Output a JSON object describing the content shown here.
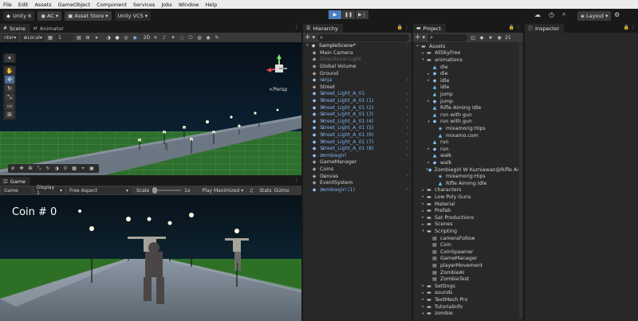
{
  "menu": [
    "File",
    "Edit",
    "Assets",
    "GameObject",
    "Component",
    "Services",
    "Jobs",
    "Window",
    "Help"
  ],
  "toolbar": {
    "unity_version": "Unity 6",
    "account": "AC",
    "asset_store": "Asset Store",
    "vcs": "Unity VCS",
    "layout": "Layout",
    "play_icons": [
      "play-icon",
      "pause-icon",
      "step-icon"
    ]
  },
  "scene_panel": {
    "tabs": [
      "Scene",
      "Animator"
    ],
    "pivot": "nter",
    "space": "Local",
    "grid_value": "1",
    "persp_label": "<Persp"
  },
  "game_panel": {
    "tab": "Game",
    "mode": "Game",
    "display": "Display 1",
    "aspect": "Free Aspect",
    "scale_label": "Scale",
    "scale_value": "1x",
    "play_mode": "Play Maximized",
    "stats": "Stats",
    "gizmos": "Gizmo",
    "hud_coin": "Coin # 0"
  },
  "hierarchy": {
    "tab": "Hierarchy",
    "scene": "SampleScene*",
    "items": [
      {
        "label": "Main Camera",
        "depth": 1,
        "icon": "cube-icon",
        "color": "grey",
        "arrow": ""
      },
      {
        "label": "Directional Light",
        "depth": 1,
        "icon": "cube-icon",
        "color": "dim",
        "arrow": ""
      },
      {
        "label": "Global Volume",
        "depth": 1,
        "icon": "cube-icon",
        "color": "grey",
        "arrow": ""
      },
      {
        "label": "Ground",
        "depth": 1,
        "icon": "cube-icon",
        "color": "grey",
        "arrow": ""
      },
      {
        "label": "ninja",
        "depth": 1,
        "icon": "prefab-icon",
        "color": "blue",
        "arrow": "▸"
      },
      {
        "label": "Street",
        "depth": 1,
        "icon": "cube-icon",
        "color": "grey",
        "arrow": ""
      },
      {
        "label": "Street_Light_A_01",
        "depth": 1,
        "icon": "prefab-icon",
        "color": "blue",
        "arrow": "▸"
      },
      {
        "label": "Street_Light_A_01 (1)",
        "depth": 1,
        "icon": "prefab-icon",
        "color": "blue",
        "arrow": "▸"
      },
      {
        "label": "Street_Light_A_01 (2)",
        "depth": 1,
        "icon": "prefab-icon",
        "color": "blue",
        "arrow": "▸"
      },
      {
        "label": "Street_Light_A_01 (3)",
        "depth": 1,
        "icon": "prefab-icon",
        "color": "blue",
        "arrow": "▸"
      },
      {
        "label": "Street_Light_A_01 (4)",
        "depth": 1,
        "icon": "prefab-icon",
        "color": "blue",
        "arrow": "▸"
      },
      {
        "label": "Street_Light_A_01 (5)",
        "depth": 1,
        "icon": "prefab-icon",
        "color": "blue",
        "arrow": "▸"
      },
      {
        "label": "Street_Light_A_01 (6)",
        "depth": 1,
        "icon": "prefab-icon",
        "color": "blue",
        "arrow": "▸"
      },
      {
        "label": "Street_Light_A_01 (7)",
        "depth": 1,
        "icon": "prefab-icon",
        "color": "blue",
        "arrow": "▸"
      },
      {
        "label": "Street_Light_A_01 (8)",
        "depth": 1,
        "icon": "prefab-icon",
        "color": "blue",
        "arrow": "▸"
      },
      {
        "label": "zombiegirl",
        "depth": 1,
        "icon": "prefab-icon",
        "color": "blue",
        "arrow": "▸"
      },
      {
        "label": "GameManager",
        "depth": 1,
        "icon": "cube-icon",
        "color": "grey",
        "arrow": ""
      },
      {
        "label": "Coins",
        "depth": 1,
        "icon": "cube-icon",
        "color": "grey",
        "arrow": ""
      },
      {
        "label": "Canvas",
        "depth": 1,
        "icon": "cube-icon",
        "color": "grey",
        "arrow": "▸"
      },
      {
        "label": "EventSystem",
        "depth": 1,
        "icon": "cube-icon",
        "color": "grey",
        "arrow": ""
      },
      {
        "label": "zombiegirl (1)",
        "depth": 1,
        "icon": "prefab-icon",
        "color": "blue",
        "arrow": "▸"
      }
    ]
  },
  "project": {
    "tab": "Project",
    "count": "21",
    "items": [
      {
        "label": "Assets",
        "depth": 0,
        "icon": "folder-icon",
        "arrow": "▾"
      },
      {
        "label": "AllSkyFree",
        "depth": 1,
        "icon": "folder-icon",
        "arrow": "▸"
      },
      {
        "label": "animations",
        "depth": 1,
        "icon": "folder-icon",
        "arrow": "▾"
      },
      {
        "label": "die",
        "depth": 2,
        "icon": "anim-icon",
        "arrow": ""
      },
      {
        "label": "die",
        "depth": 2,
        "icon": "model-icon",
        "arrow": "▸"
      },
      {
        "label": "idle",
        "depth": 2,
        "icon": "model-icon",
        "arrow": "▸"
      },
      {
        "label": "idle",
        "depth": 2,
        "icon": "anim-icon",
        "arrow": ""
      },
      {
        "label": "jump",
        "depth": 2,
        "icon": "anim-icon",
        "arrow": ""
      },
      {
        "label": "jump",
        "depth": 2,
        "icon": "model-icon",
        "arrow": "▸"
      },
      {
        "label": "Rifle Aiming Idle",
        "depth": 2,
        "icon": "anim-icon",
        "arrow": ""
      },
      {
        "label": "run with gun",
        "depth": 2,
        "icon": "anim-icon",
        "arrow": ""
      },
      {
        "label": "run with gun",
        "depth": 2,
        "icon": "model-icon",
        "arrow": "▾"
      },
      {
        "label": "mixamorig:Hips",
        "depth": 3,
        "icon": "cube-icon",
        "arrow": ""
      },
      {
        "label": "mixamo.com",
        "depth": 3,
        "icon": "anim-icon",
        "arrow": ""
      },
      {
        "label": "run",
        "depth": 2,
        "icon": "anim-icon",
        "arrow": ""
      },
      {
        "label": "run",
        "depth": 2,
        "icon": "model-icon",
        "arrow": "▸"
      },
      {
        "label": "walk",
        "depth": 2,
        "icon": "anim-icon",
        "arrow": ""
      },
      {
        "label": "walk",
        "depth": 2,
        "icon": "model-icon",
        "arrow": "▸"
      },
      {
        "label": "Zombiegirl W Kurniawan@Rifle Ai",
        "depth": 2,
        "icon": "model-icon",
        "arrow": "▾"
      },
      {
        "label": "mixamorig:Hips",
        "depth": 3,
        "icon": "cube-icon",
        "arrow": ""
      },
      {
        "label": "Rifle Aiming Idle",
        "depth": 3,
        "icon": "anim-icon",
        "arrow": ""
      },
      {
        "label": "characters",
        "depth": 1,
        "icon": "folder-icon",
        "arrow": "▸"
      },
      {
        "label": "Low Poly Guns",
        "depth": 1,
        "icon": "folder-icon",
        "arrow": "▸"
      },
      {
        "label": "Material",
        "depth": 1,
        "icon": "folder-icon",
        "arrow": "▸"
      },
      {
        "label": "Prefab",
        "depth": 1,
        "icon": "folder-icon",
        "arrow": "▸"
      },
      {
        "label": "Sat Productions",
        "depth": 1,
        "icon": "folder-icon",
        "arrow": "▸"
      },
      {
        "label": "Scenes",
        "depth": 1,
        "icon": "folder-icon",
        "arrow": "▸"
      },
      {
        "label": "Scripting",
        "depth": 1,
        "icon": "folder-icon",
        "arrow": "▾"
      },
      {
        "label": "cameraFollow",
        "depth": 2,
        "icon": "script-icon",
        "arrow": ""
      },
      {
        "label": "Coin",
        "depth": 2,
        "icon": "script-icon",
        "arrow": ""
      },
      {
        "label": "CoinSpawner",
        "depth": 2,
        "icon": "script-icon",
        "arrow": ""
      },
      {
        "label": "GameManager",
        "depth": 2,
        "icon": "script-icon",
        "arrow": ""
      },
      {
        "label": "playerMovement",
        "depth": 2,
        "icon": "script-icon",
        "arrow": ""
      },
      {
        "label": "ZombieAI",
        "depth": 2,
        "icon": "script-icon",
        "arrow": ""
      },
      {
        "label": "ZombieTest",
        "depth": 2,
        "icon": "script-icon",
        "arrow": ""
      },
      {
        "label": "Settings",
        "depth": 1,
        "icon": "folder-icon",
        "arrow": "▸"
      },
      {
        "label": "sounds",
        "depth": 1,
        "icon": "folder-icon",
        "arrow": "▸"
      },
      {
        "label": "TextMesh Pro",
        "depth": 1,
        "icon": "folder-icon",
        "arrow": "▸"
      },
      {
        "label": "TutorialInfo",
        "depth": 1,
        "icon": "folder-icon",
        "arrow": "▸"
      },
      {
        "label": "zombie",
        "depth": 1,
        "icon": "folder-icon",
        "arrow": "▾"
      }
    ]
  },
  "inspector": {
    "tab": "Inspector"
  },
  "colors": {
    "accent": "#4d7fbf",
    "prefab": "#7ab2ef",
    "grass": "#2e7d2e",
    "sky": "#0a1722"
  }
}
